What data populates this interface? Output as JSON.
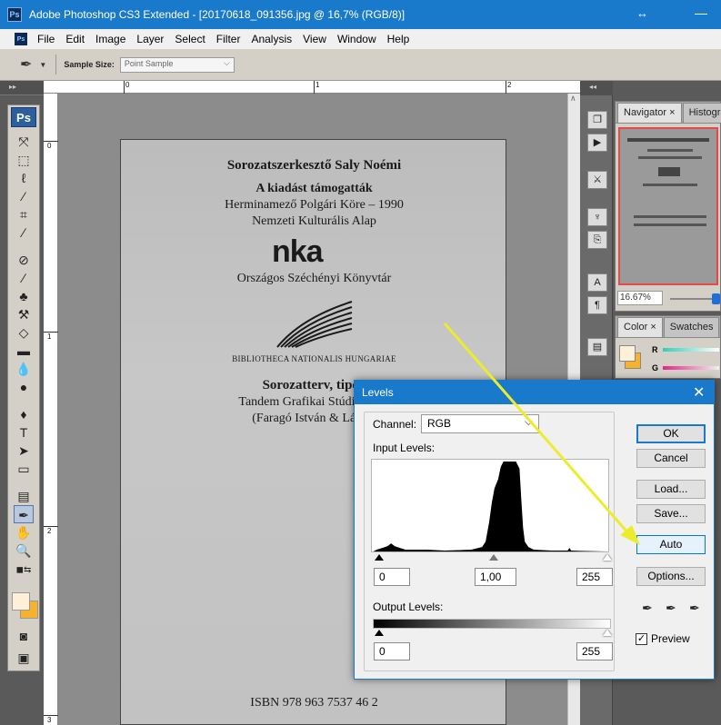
{
  "window": {
    "title": "Adobe Photoshop CS3 Extended - [20170618_091356.jpg @ 16,7% (RGB/8)]",
    "logo": "Ps"
  },
  "menu": [
    "File",
    "Edit",
    "Image",
    "Layer",
    "Select",
    "Filter",
    "Analysis",
    "View",
    "Window",
    "Help"
  ],
  "options": {
    "sample_size_label": "Sample Size:",
    "sample_size_value": "Point Sample"
  },
  "toolbox": {
    "badge": "Ps"
  },
  "rulers": {
    "h": [
      "0",
      "1",
      "2"
    ],
    "v": [
      "0",
      "1",
      "2",
      "3"
    ]
  },
  "document": {
    "line1": "Sorozatszerkesztő Saly Noémi",
    "line2": "A kiadást támogatták",
    "line3": "Herminamező Polgári Köre – 1990",
    "line4": "Nemzeti Kulturális Alap",
    "logo_nka": "nka",
    "line5": "Országos Széchényi Könyvtár",
    "line6": "BIBLIOTHECA NATIONALIS HUNGARIAE",
    "line7": "Sorozatterv, tipog",
    "line8": "Tandem Grafikai Stúdió – tan",
    "line9": "(Faragó István & László",
    "isbn": "ISBN 978 963 7537 46 2"
  },
  "navigator": {
    "tabs": [
      "Navigator ×",
      "Histogra"
    ],
    "zoom": "16.67%"
  },
  "color_panel": {
    "tabs": [
      "Color ×",
      "Swatches"
    ],
    "r_label": "R",
    "g_label": "G",
    "fg": "#fdf0d8",
    "bg": "#f7b12d"
  },
  "levels": {
    "title": "Levels",
    "channel_label": "Channel:",
    "channel_value": "RGB",
    "input_label": "Input Levels:",
    "input_black": "0",
    "input_gamma": "1,00",
    "input_white": "255",
    "output_label": "Output Levels:",
    "output_black": "0",
    "output_white": "255",
    "buttons": {
      "ok": "OK",
      "cancel": "Cancel",
      "load": "Load...",
      "save": "Save...",
      "auto": "Auto",
      "options": "Options..."
    },
    "preview_label": "Preview",
    "preview_checked": true
  }
}
